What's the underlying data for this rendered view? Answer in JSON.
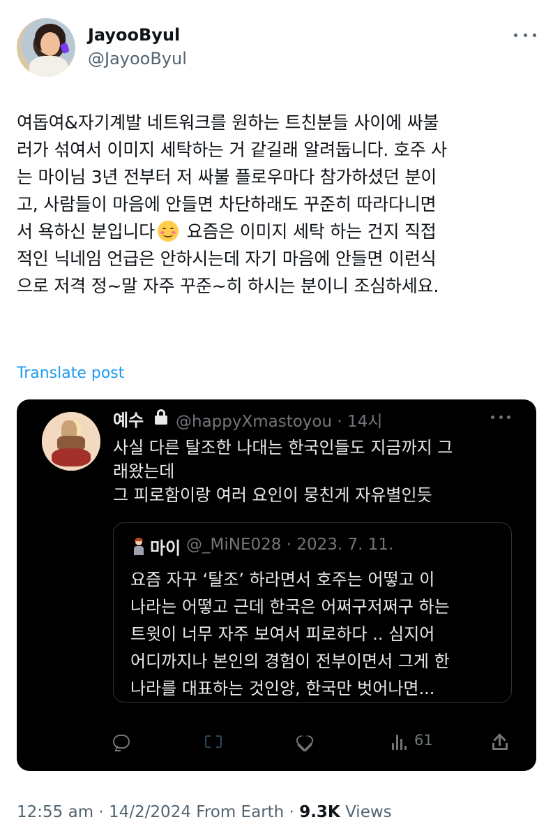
{
  "author": {
    "display_name": "JayooByul",
    "handle": "@JayooByul"
  },
  "tweet": {
    "text_part1": "여돕여&자기계발 네트워크를 원하는 트친분들 사이에 싸불\n러가 섞여서 이미지 세탁하는 거 같길래 알려둡니다. 호주 사\n는 마이님 3년 전부터 저 싸불 플로우마다 참가하셨던 분이\n고, 사람들이 마음에 안들면 차단하래도 꾸준히 따라다니면\n서 욕하신 분입니다",
    "emoji": "smiling-face-with-smiling-eyes",
    "text_part2": " 요즘은 이미지 세탁 하는 건지 직접\n적인 닉네임 언급은 안하시는데 자기 마음에 안들면 이런식\n으로 저격 정~말 자주 꾸준~히 하시는 분이니 조심하세요.",
    "translate_label": "Translate post"
  },
  "quoted": {
    "name": "예수",
    "handle_time": "@happyXmastoyou · 14시",
    "text": "사실 다른 탈조한 나대는 한국인들도 지금까지 그\n래왔는데\n그 피로함이랑 여러 요인이 뭉친게 자유별인듯",
    "inner": {
      "name": "마이",
      "handle_time": "@_MiNE028 · 2023. 7. 11.",
      "text": "요즘 자꾸 ‘탈조’ 하라면서 호주는 어떻고 이\n나라는 어떻고 근데 한국은 어쩌구저쩌구 하는\n트윗이 너무 자주 보여서 피로하다 .. 심지어\n어디까지나 본인의 경험이 전부이면서 그게 한\n나라를 대표하는 것인양, 한국만 벗어나면..."
    },
    "views": "61"
  },
  "meta": {
    "time_date_source": "12:55 am · 14/2/2024 From Earth · ",
    "views_count": "9.3K",
    "views_label": " Views"
  },
  "colors": {
    "link": "#1d9bf0",
    "secondary_text": "#536471",
    "card_background": "#000000"
  }
}
